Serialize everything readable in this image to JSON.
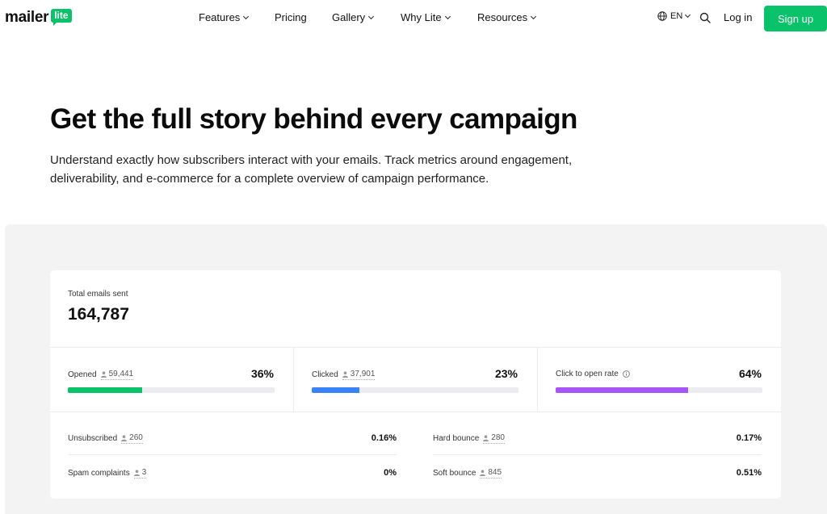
{
  "brand": {
    "word": "mailer",
    "badge": "lite",
    "accent": "#09c269"
  },
  "nav": {
    "items": [
      {
        "label": "Features",
        "dropdown": true
      },
      {
        "label": "Pricing",
        "dropdown": false
      },
      {
        "label": "Gallery",
        "dropdown": true
      },
      {
        "label": "Why Lite",
        "dropdown": true
      },
      {
        "label": "Resources",
        "dropdown": true
      }
    ],
    "language": "EN",
    "login": "Log in",
    "signup": "Sign up"
  },
  "hero": {
    "title": "Get the full story behind every campaign",
    "subtitle": "Understand exactly how subscribers interact with your emails. Track metrics around engagement, deliverability, and e-commerce for a complete overview of campaign performance."
  },
  "stats": {
    "total_label": "Total emails sent",
    "total_value": "164,787",
    "metrics": [
      {
        "label": "Opened",
        "count": "59,441",
        "percent": "36%",
        "fill": 0.36,
        "color": "#09c269",
        "info": false
      },
      {
        "label": "Clicked",
        "count": "37,901",
        "percent": "23%",
        "fill": 0.23,
        "color": "#3b82f6",
        "info": false
      },
      {
        "label": "Click to open rate",
        "count": "",
        "percent": "64%",
        "fill": 0.64,
        "color": "#a855f7",
        "info": true
      }
    ],
    "rows": [
      {
        "label": "Unsubscribed",
        "count": "260",
        "percent": "0.16%"
      },
      {
        "label": "Hard bounce",
        "count": "280",
        "percent": "0.17%"
      },
      {
        "label": "Spam complaints",
        "count": "3",
        "percent": "0%"
      },
      {
        "label": "Soft bounce",
        "count": "845",
        "percent": "0.51%"
      }
    ]
  }
}
